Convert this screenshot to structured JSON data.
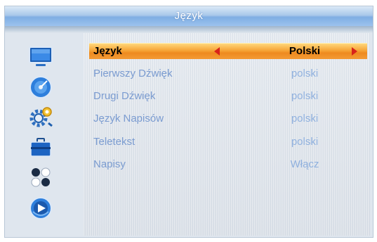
{
  "window": {
    "title": "Język"
  },
  "sidebar": {
    "icons": [
      "tv-icon",
      "disc-icon",
      "settings-gear-icon",
      "toolbox-icon",
      "apps-grid-icon",
      "media-player-icon"
    ],
    "active": "settings-gear-icon"
  },
  "menu": {
    "selected_index": 0,
    "rows": [
      {
        "label": "Język",
        "value": "Polski"
      },
      {
        "label": "Pierwszy Dźwięk",
        "value": "polski"
      },
      {
        "label": "Drugi Dźwięk",
        "value": "polski"
      },
      {
        "label": "Język Napisów",
        "value": "polski"
      },
      {
        "label": "Teletekst",
        "value": "polski"
      },
      {
        "label": "Napisy",
        "value": "Włącz"
      }
    ]
  },
  "colors": {
    "title_bar": "#7faee3",
    "highlight": "#f6a436",
    "label_text": "#7a9bd0",
    "arrow": "#d8231a"
  }
}
